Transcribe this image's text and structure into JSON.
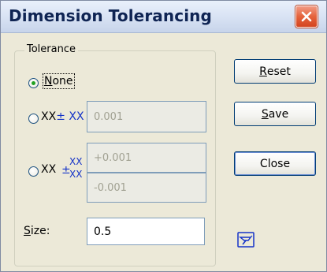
{
  "window": {
    "title": "Dimension Tolerancing"
  },
  "tolerance_group": {
    "label": "Tolerance",
    "options": {
      "none": {
        "label": "None",
        "mnemonic": "N",
        "selected": true
      },
      "symmetric": {
        "prefix": "XX",
        "symbol": "±",
        "suffix": "XX",
        "value": "0.001",
        "selected": false
      },
      "deviation": {
        "prefix": "XX",
        "symbol": "±",
        "stack_top": "XX",
        "stack_bottom": "XX",
        "upper_value": "+0.001",
        "lower_value": "-0.001",
        "selected": false
      }
    }
  },
  "size": {
    "label": "Size:",
    "mnemonic": "S",
    "value": "0.5"
  },
  "buttons": {
    "reset": "Reset",
    "save": "Save",
    "close": "Close"
  },
  "colors": {
    "accent_blue": "#1433c8",
    "radio_dot": "#21a121"
  },
  "icons": {
    "window_close": "close-x-icon",
    "help": "pin-icon"
  }
}
